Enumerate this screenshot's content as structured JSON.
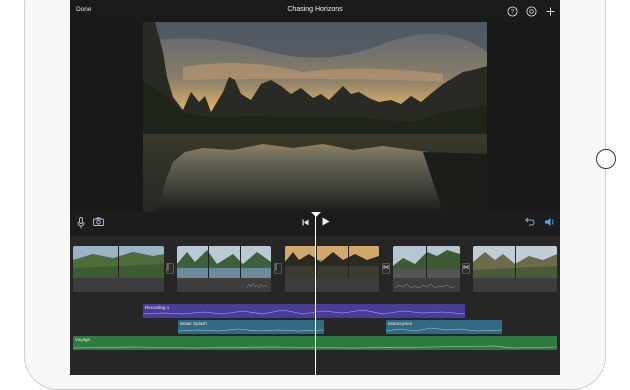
{
  "header": {
    "done_label": "Done",
    "project_title": "Chasing Horizons",
    "help_icon": "question-circle-icon",
    "settings_icon": "gear-icon",
    "add_icon": "plus-icon"
  },
  "toolbar": {
    "mic_icon": "microphone-icon",
    "camera_icon": "camera-icon",
    "skip_back_icon": "skip-to-start-icon",
    "play_icon": "play-icon",
    "undo_icon": "undo-icon",
    "audio_icon": "audio-settings-icon"
  },
  "timeline": {
    "transitions": [
      "dissolve",
      "dissolve",
      "bowtie",
      "bowtie"
    ],
    "audio_clips": [
      {
        "name": "Recording 1",
        "color": "#4a3d9a"
      },
      {
        "name": "Water Splash",
        "color": "#2f6a82"
      },
      {
        "name": "Motorcycles",
        "color": "#2f6a82"
      },
      {
        "name": "Voyage",
        "color": "#2e7a40"
      }
    ]
  },
  "colors": {
    "accent": "#6fb6f0",
    "background": "#1b1b1b"
  }
}
